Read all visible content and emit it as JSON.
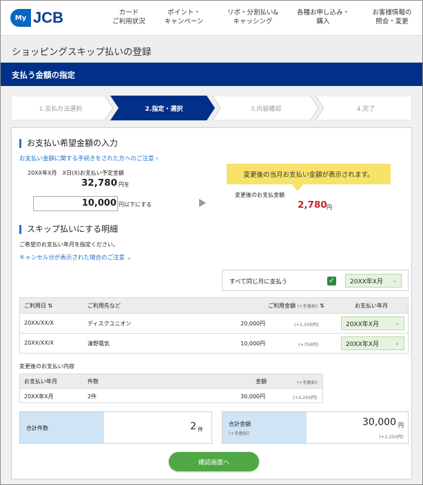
{
  "header": {
    "logo_my": "My",
    "logo_jcb": "JCB",
    "nav": [
      {
        "label": "カード\nご利用状況"
      },
      {
        "label": "ポイント・\nキャンペーン"
      },
      {
        "label": "リボ・分割払い&\nキャッシング"
      },
      {
        "label": "各種お申し込み・\n購入"
      },
      {
        "label": "お客様情報の\n照会・変更"
      }
    ]
  },
  "page_title": "ショッピングスキップ払いの登録",
  "section_band": "支払う金額の指定",
  "steps": [
    "1.支払方法選択",
    "2.指定・選択",
    "3.内容確認",
    "4.完了"
  ],
  "active_step": 2,
  "payment": {
    "heading": "お支払い希望金額の入力",
    "notice_link": "お支払い金額に関する手続きをされた方へのご注意",
    "scheduled_label": "20XX年X月　X日(X)お支払い予定金額",
    "scheduled_amount": "32,780",
    "scheduled_suffix": "円を",
    "input_value": "10,000",
    "input_suffix": "円以下にする",
    "tooltip": "変更後の当月お支払い金額が表示されます。",
    "changed_label": "変更後のお支払金額",
    "changed_amount": "2,780",
    "changed_suffix": "円"
  },
  "skip": {
    "heading": "スキップ払いにする明細",
    "instruction": "ご希望のお支払い年月を指定ください。",
    "cancel_link": "キャンセル分が表示された場合のご注意",
    "same_month_label": "すべて同じ月に支払う",
    "same_month_checked": true,
    "same_month_select": "20XX年X月",
    "columns": {
      "date": "ご利用日",
      "merchant": "ご利用先など",
      "amount": "ご利用金額",
      "amount_note": "(+手数料)",
      "month": "お支払い年月"
    },
    "rows": [
      {
        "date": "20XX/XX/X",
        "merchant": "ディスクユニオン",
        "amount": "20,000円",
        "fee": "(+1,500円)",
        "month": "20XX年X月"
      },
      {
        "date": "20XX/XX/X",
        "merchant": "清野電気",
        "amount": "10,000円",
        "fee": "(+750円)",
        "month": "20XX年X月"
      }
    ]
  },
  "after": {
    "title": "変更後のお支払い内容",
    "columns": {
      "month": "お支払い年月",
      "count": "件数",
      "amount": "金額",
      "amount_note": "(+手数料)"
    },
    "row": {
      "month": "20XX年X月",
      "count": "2件",
      "amount": "30,000円",
      "fee": "(+2,250円)"
    }
  },
  "totals": {
    "count_label": "合計件数",
    "count_value": "2",
    "count_unit": "件",
    "amount_label": "合計金額",
    "amount_label_note": "(+手数料)",
    "amount_value": "30,000",
    "amount_unit": "円",
    "amount_fee": "(+2,250円)"
  },
  "confirm_button": "確認画面へ",
  "colors": {
    "brand_blue": "#003087",
    "accent_blue": "#2a6fc9",
    "green": "#4fa843",
    "red_amount": "#c0262c",
    "tooltip": "#f7e26a"
  }
}
